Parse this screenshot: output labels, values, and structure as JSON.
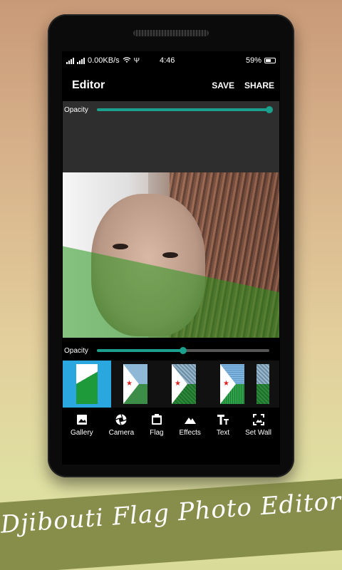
{
  "status": {
    "network": "0.00KB/s",
    "time": "4:46",
    "battery": "59%"
  },
  "appbar": {
    "title": "Editor",
    "save_label": "SAVE",
    "share_label": "SHARE"
  },
  "top_opacity": {
    "label": "Opacity",
    "value": 1.0
  },
  "bottom_opacity": {
    "label": "Opacity",
    "value": 0.5
  },
  "toolbar": {
    "items": [
      {
        "label": "Gallery",
        "icon": "gallery-icon"
      },
      {
        "label": "Camera",
        "icon": "camera-icon"
      },
      {
        "label": "Flag",
        "icon": "flag-icon"
      },
      {
        "label": "Effects",
        "icon": "effects-icon"
      },
      {
        "label": "Text",
        "icon": "text-icon"
      },
      {
        "label": "Set Wall",
        "icon": "set-wall-icon"
      }
    ]
  },
  "banner": {
    "text": "Djibouti Flag Photo Editor"
  },
  "colors": {
    "accent": "#1aa08c",
    "selected": "#2aa7de",
    "banner": "#78803c"
  }
}
